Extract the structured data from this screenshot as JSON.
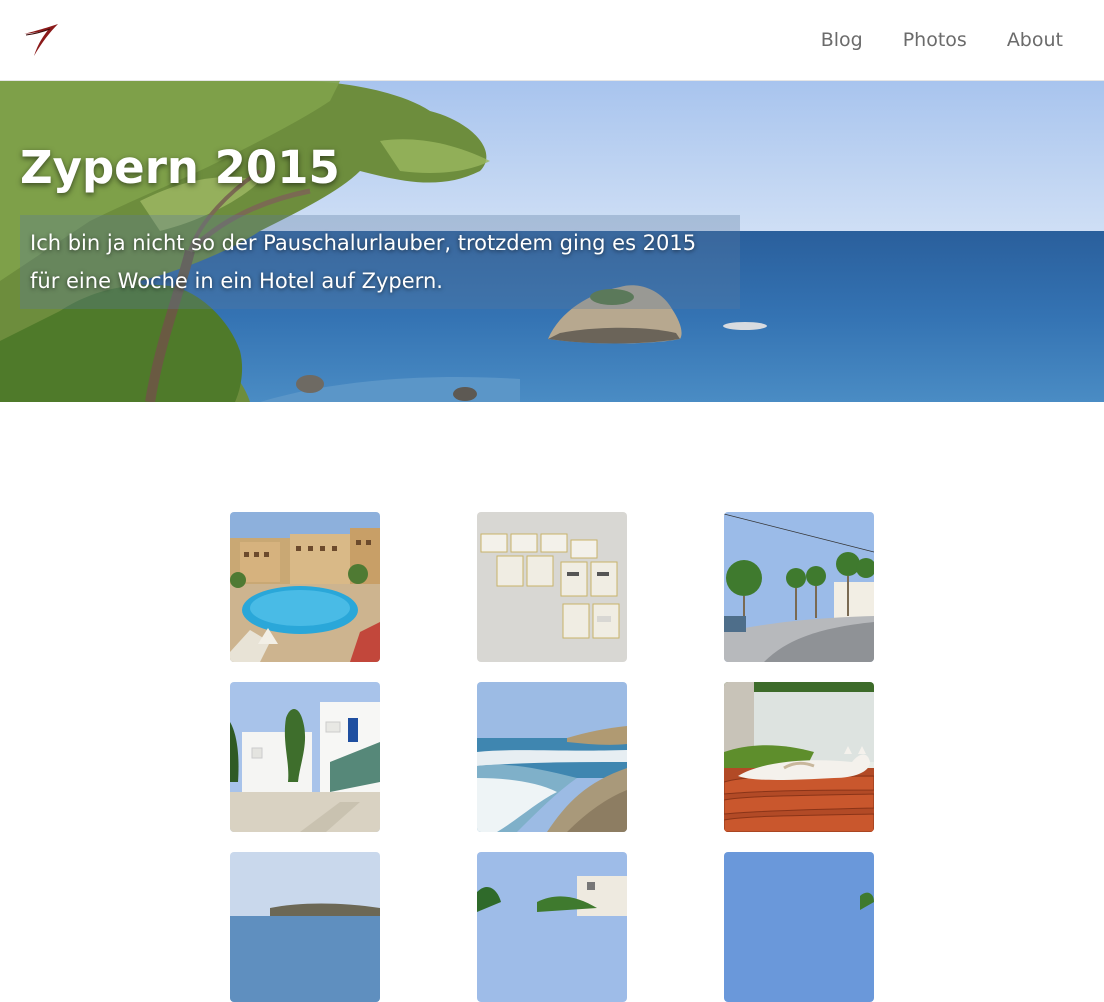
{
  "header": {
    "logo_name": "site-logo",
    "nav": [
      {
        "label": "Blog"
      },
      {
        "label": "Photos"
      },
      {
        "label": "About"
      }
    ]
  },
  "hero": {
    "title": "Zypern 2015",
    "intro": "Ich bin ja nicht so der Pauschalurlauber, trotzdem ging es 2015 für eine Woche in ein Hotel auf Zypern."
  },
  "gallery": {
    "items": [
      {
        "scene": "hotel-pool"
      },
      {
        "scene": "mailboxes"
      },
      {
        "scene": "palm-street"
      },
      {
        "scene": "white-houses"
      },
      {
        "scene": "beach-waves"
      },
      {
        "scene": "cat-on-roof"
      },
      {
        "scene": "coast-hill"
      },
      {
        "scene": "village-palms"
      },
      {
        "scene": "blue-sky-trees"
      }
    ]
  },
  "colors": {
    "nav_text": "#6b6b6b",
    "logo_red": "#8b1a1a",
    "sea_blue": "#2f6aa6",
    "sky_blue": "#a9c6ef"
  }
}
